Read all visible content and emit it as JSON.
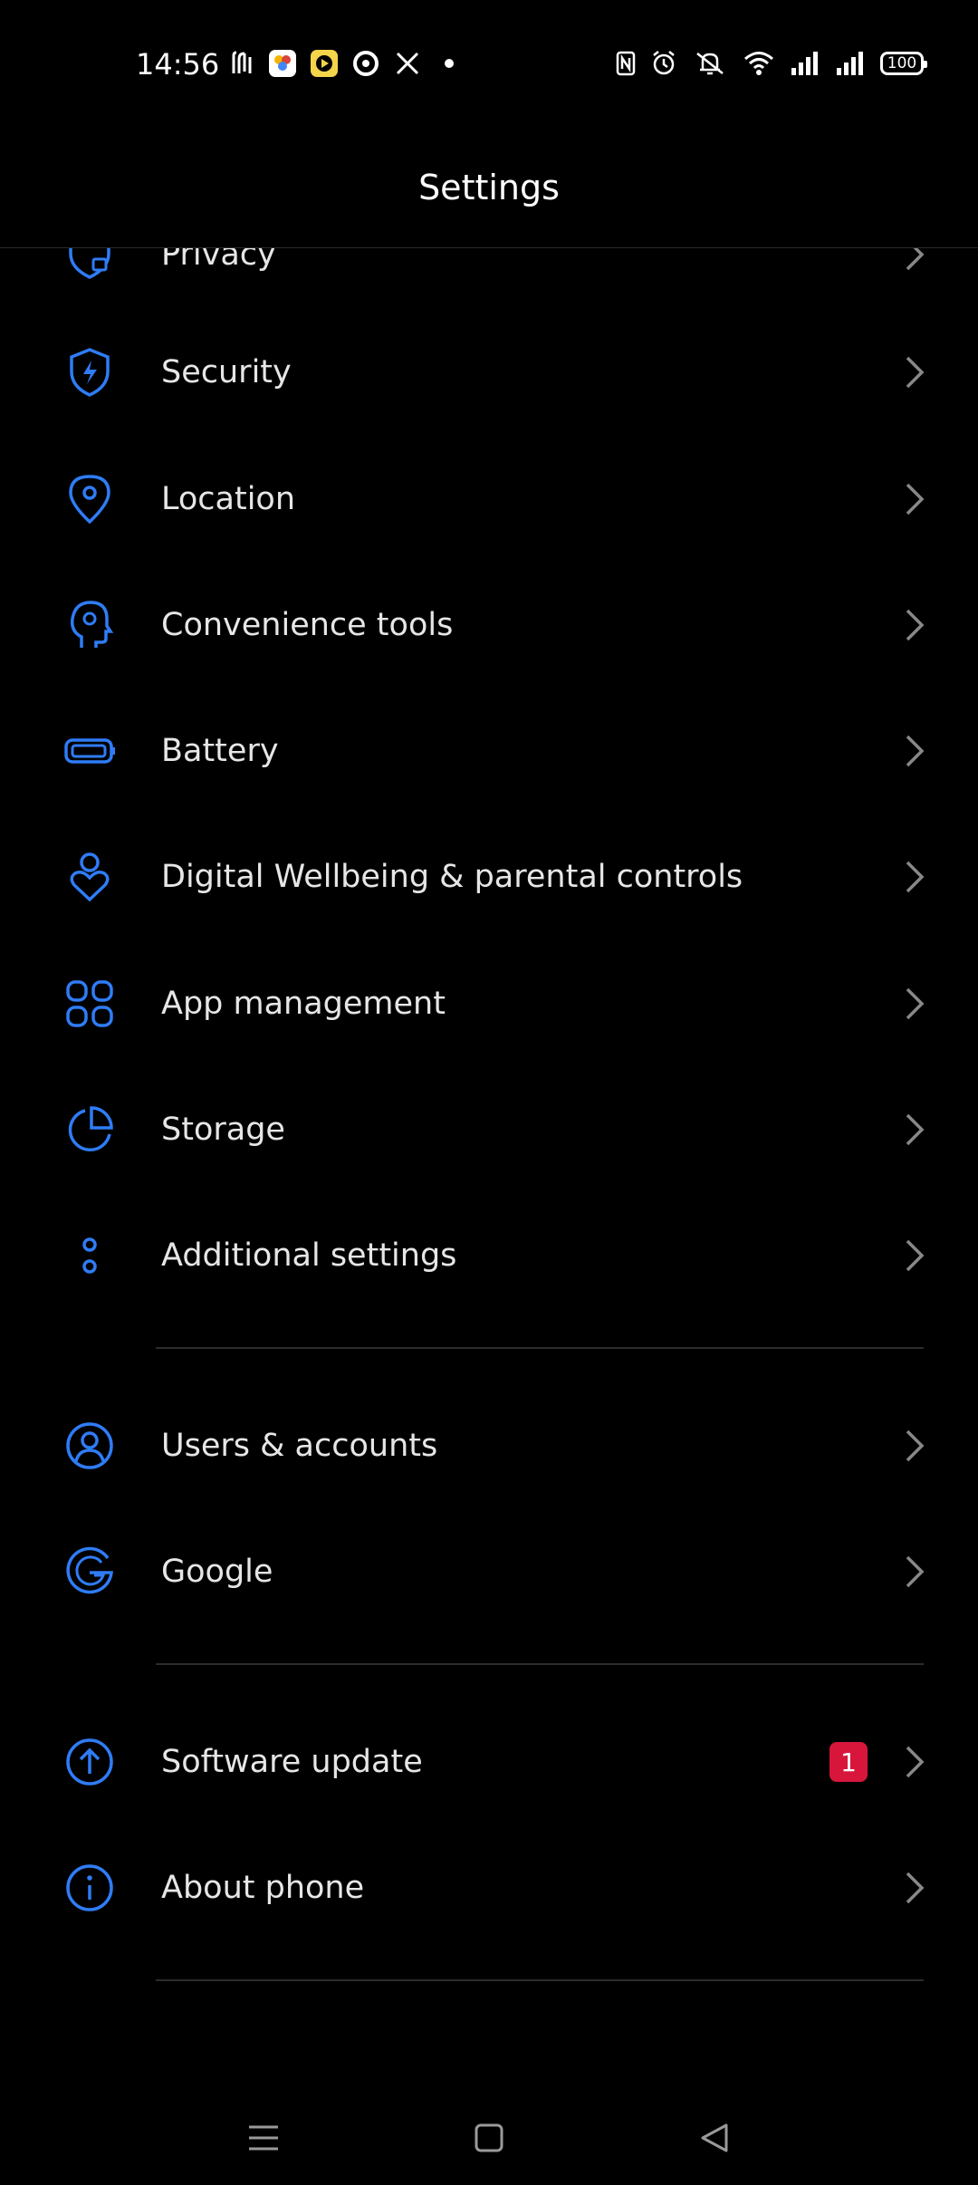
{
  "status_bar": {
    "time": "14:56",
    "battery_level": "100",
    "notification_icons": [
      "music-icon",
      "photos-icon",
      "app-icon",
      "circle-app-icon",
      "x-icon",
      "dot-icon"
    ],
    "system_icons": [
      "nfc-icon",
      "alarm-icon",
      "mute-icon",
      "wifi-icon",
      "signal-icon",
      "signal-icon"
    ]
  },
  "header": {
    "title": "Settings"
  },
  "settings": {
    "group1": [
      {
        "label": "Privacy",
        "icon": "privacy-icon"
      },
      {
        "label": "Security",
        "icon": "security-icon"
      },
      {
        "label": "Location",
        "icon": "location-icon"
      },
      {
        "label": "Convenience tools",
        "icon": "convenience-tools-icon"
      },
      {
        "label": "Battery",
        "icon": "battery-icon"
      },
      {
        "label": "Digital Wellbeing & parental controls",
        "icon": "wellbeing-icon"
      },
      {
        "label": "App management",
        "icon": "apps-icon"
      },
      {
        "label": "Storage",
        "icon": "storage-icon"
      },
      {
        "label": "Additional settings",
        "icon": "additional-settings-icon"
      }
    ],
    "group2": [
      {
        "label": "Users & accounts",
        "icon": "users-icon"
      },
      {
        "label": "Google",
        "icon": "google-icon"
      }
    ],
    "group3": [
      {
        "label": "Software update",
        "icon": "software-update-icon",
        "badge": "1"
      },
      {
        "label": "About phone",
        "icon": "about-phone-icon"
      }
    ]
  },
  "colors": {
    "accent": "#2f7cf6",
    "badge": "#d8163c",
    "background": "#000000"
  },
  "nav_bar": [
    "menu-icon",
    "home-icon",
    "back-icon"
  ]
}
